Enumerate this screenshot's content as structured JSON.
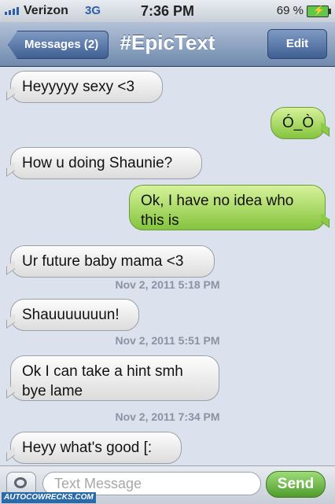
{
  "status_bar": {
    "carrier": "Verizon",
    "network": "3G",
    "time": "7:36 PM",
    "battery": "69 %"
  },
  "nav": {
    "back_label": "Messages (2)",
    "title": "#EpicText",
    "edit_label": "Edit"
  },
  "messages": [
    {
      "from": "them",
      "text": "Heyyyyy sexy <3"
    },
    {
      "from": "me",
      "text": "Ó_Ò"
    },
    {
      "from": "them",
      "text": "How u doing Shaunie?"
    },
    {
      "from": "me",
      "text": "Ok, I have no idea who this is"
    },
    {
      "from": "them",
      "text": "Ur future baby mama <3"
    },
    {
      "timestamp": "Nov 2, 2011 5:18 PM"
    },
    {
      "from": "them",
      "text": "Shauuuuuuun!"
    },
    {
      "timestamp": "Nov 2, 2011 5:51 PM"
    },
    {
      "from": "them",
      "text": "Ok I can take a hint smh bye lame"
    },
    {
      "timestamp": "Nov 2, 2011 7:34 PM"
    },
    {
      "from": "them",
      "text": "Heyy what's good [:"
    }
  ],
  "input": {
    "placeholder": "Text Message",
    "send_label": "Send"
  },
  "watermark": "AUTOCOWRECKS.COM",
  "icons": [
    "signal-bars-icon",
    "battery-icon",
    "camera-icon"
  ]
}
